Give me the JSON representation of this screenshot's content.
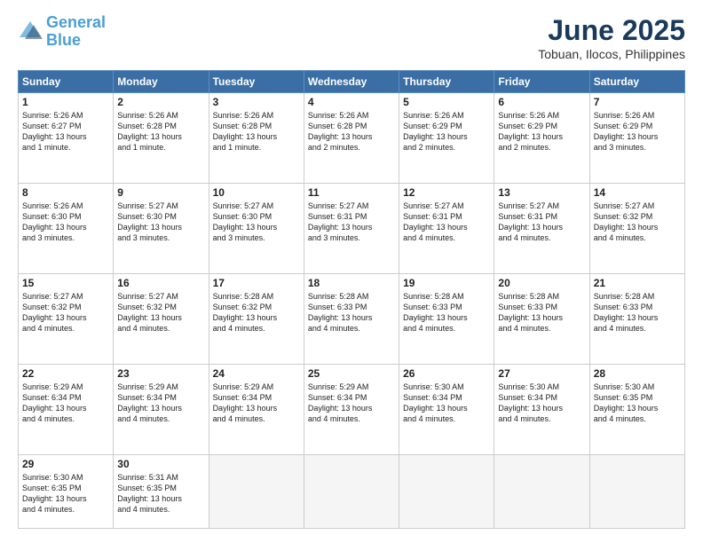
{
  "logo": {
    "line1": "General",
    "line2": "Blue"
  },
  "title": "June 2025",
  "subtitle": "Tobuan, Ilocos, Philippines",
  "weekdays": [
    "Sunday",
    "Monday",
    "Tuesday",
    "Wednesday",
    "Thursday",
    "Friday",
    "Saturday"
  ],
  "weeks": [
    [
      {
        "day": "1",
        "info": "Sunrise: 5:26 AM\nSunset: 6:27 PM\nDaylight: 13 hours\nand 1 minute."
      },
      {
        "day": "2",
        "info": "Sunrise: 5:26 AM\nSunset: 6:28 PM\nDaylight: 13 hours\nand 1 minute."
      },
      {
        "day": "3",
        "info": "Sunrise: 5:26 AM\nSunset: 6:28 PM\nDaylight: 13 hours\nand 1 minute."
      },
      {
        "day": "4",
        "info": "Sunrise: 5:26 AM\nSunset: 6:28 PM\nDaylight: 13 hours\nand 2 minutes."
      },
      {
        "day": "5",
        "info": "Sunrise: 5:26 AM\nSunset: 6:29 PM\nDaylight: 13 hours\nand 2 minutes."
      },
      {
        "day": "6",
        "info": "Sunrise: 5:26 AM\nSunset: 6:29 PM\nDaylight: 13 hours\nand 2 minutes."
      },
      {
        "day": "7",
        "info": "Sunrise: 5:26 AM\nSunset: 6:29 PM\nDaylight: 13 hours\nand 3 minutes."
      }
    ],
    [
      {
        "day": "8",
        "info": "Sunrise: 5:26 AM\nSunset: 6:30 PM\nDaylight: 13 hours\nand 3 minutes."
      },
      {
        "day": "9",
        "info": "Sunrise: 5:27 AM\nSunset: 6:30 PM\nDaylight: 13 hours\nand 3 minutes."
      },
      {
        "day": "10",
        "info": "Sunrise: 5:27 AM\nSunset: 6:30 PM\nDaylight: 13 hours\nand 3 minutes."
      },
      {
        "day": "11",
        "info": "Sunrise: 5:27 AM\nSunset: 6:31 PM\nDaylight: 13 hours\nand 3 minutes."
      },
      {
        "day": "12",
        "info": "Sunrise: 5:27 AM\nSunset: 6:31 PM\nDaylight: 13 hours\nand 4 minutes."
      },
      {
        "day": "13",
        "info": "Sunrise: 5:27 AM\nSunset: 6:31 PM\nDaylight: 13 hours\nand 4 minutes."
      },
      {
        "day": "14",
        "info": "Sunrise: 5:27 AM\nSunset: 6:32 PM\nDaylight: 13 hours\nand 4 minutes."
      }
    ],
    [
      {
        "day": "15",
        "info": "Sunrise: 5:27 AM\nSunset: 6:32 PM\nDaylight: 13 hours\nand 4 minutes."
      },
      {
        "day": "16",
        "info": "Sunrise: 5:27 AM\nSunset: 6:32 PM\nDaylight: 13 hours\nand 4 minutes."
      },
      {
        "day": "17",
        "info": "Sunrise: 5:28 AM\nSunset: 6:32 PM\nDaylight: 13 hours\nand 4 minutes."
      },
      {
        "day": "18",
        "info": "Sunrise: 5:28 AM\nSunset: 6:33 PM\nDaylight: 13 hours\nand 4 minutes."
      },
      {
        "day": "19",
        "info": "Sunrise: 5:28 AM\nSunset: 6:33 PM\nDaylight: 13 hours\nand 4 minutes."
      },
      {
        "day": "20",
        "info": "Sunrise: 5:28 AM\nSunset: 6:33 PM\nDaylight: 13 hours\nand 4 minutes."
      },
      {
        "day": "21",
        "info": "Sunrise: 5:28 AM\nSunset: 6:33 PM\nDaylight: 13 hours\nand 4 minutes."
      }
    ],
    [
      {
        "day": "22",
        "info": "Sunrise: 5:29 AM\nSunset: 6:34 PM\nDaylight: 13 hours\nand 4 minutes."
      },
      {
        "day": "23",
        "info": "Sunrise: 5:29 AM\nSunset: 6:34 PM\nDaylight: 13 hours\nand 4 minutes."
      },
      {
        "day": "24",
        "info": "Sunrise: 5:29 AM\nSunset: 6:34 PM\nDaylight: 13 hours\nand 4 minutes."
      },
      {
        "day": "25",
        "info": "Sunrise: 5:29 AM\nSunset: 6:34 PM\nDaylight: 13 hours\nand 4 minutes."
      },
      {
        "day": "26",
        "info": "Sunrise: 5:30 AM\nSunset: 6:34 PM\nDaylight: 13 hours\nand 4 minutes."
      },
      {
        "day": "27",
        "info": "Sunrise: 5:30 AM\nSunset: 6:34 PM\nDaylight: 13 hours\nand 4 minutes."
      },
      {
        "day": "28",
        "info": "Sunrise: 5:30 AM\nSunset: 6:35 PM\nDaylight: 13 hours\nand 4 minutes."
      }
    ],
    [
      {
        "day": "29",
        "info": "Sunrise: 5:30 AM\nSunset: 6:35 PM\nDaylight: 13 hours\nand 4 minutes."
      },
      {
        "day": "30",
        "info": "Sunrise: 5:31 AM\nSunset: 6:35 PM\nDaylight: 13 hours\nand 4 minutes."
      },
      {
        "day": "",
        "info": ""
      },
      {
        "day": "",
        "info": ""
      },
      {
        "day": "",
        "info": ""
      },
      {
        "day": "",
        "info": ""
      },
      {
        "day": "",
        "info": ""
      }
    ]
  ]
}
